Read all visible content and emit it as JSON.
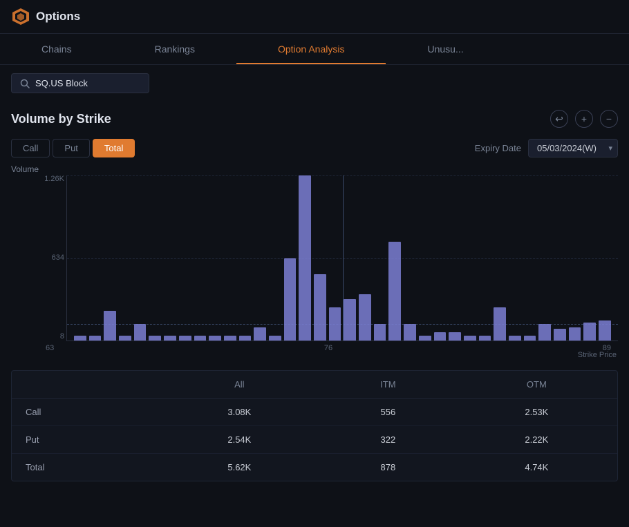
{
  "app": {
    "title": "Options"
  },
  "nav": {
    "tabs": [
      {
        "id": "chains",
        "label": "Chains",
        "active": false
      },
      {
        "id": "rankings",
        "label": "Rankings",
        "active": false
      },
      {
        "id": "option-analysis",
        "label": "Option Analysis",
        "active": true
      },
      {
        "id": "unusual",
        "label": "Unusu...",
        "active": false
      }
    ]
  },
  "search": {
    "value": "SQ.US Block",
    "placeholder": "Search..."
  },
  "section": {
    "title": "Volume by Strike",
    "toolbar": {
      "reset": "↩",
      "zoom_in": "+",
      "zoom_out": "−"
    }
  },
  "filters": {
    "buttons": [
      {
        "id": "call",
        "label": "Call",
        "active": false
      },
      {
        "id": "put",
        "label": "Put",
        "active": false
      },
      {
        "id": "total",
        "label": "Total",
        "active": true
      }
    ],
    "expiry_label": "Expiry Date",
    "expiry_value": "05/03/2024(W)"
  },
  "chart": {
    "y_labels": [
      "1.26K",
      "634",
      "8"
    ],
    "x_labels": [
      "63",
      "76",
      "89"
    ],
    "strike_label": "Strike Price",
    "volume_label": "Volume",
    "bars": [
      {
        "height_pct": 3
      },
      {
        "height_pct": 3
      },
      {
        "height_pct": 18
      },
      {
        "height_pct": 3
      },
      {
        "height_pct": 10
      },
      {
        "height_pct": 3
      },
      {
        "height_pct": 3
      },
      {
        "height_pct": 3
      },
      {
        "height_pct": 3
      },
      {
        "height_pct": 3
      },
      {
        "height_pct": 3
      },
      {
        "height_pct": 3
      },
      {
        "height_pct": 8
      },
      {
        "height_pct": 3
      },
      {
        "height_pct": 50
      },
      {
        "height_pct": 100
      },
      {
        "height_pct": 40
      },
      {
        "height_pct": 20
      },
      {
        "height_pct": 25
      },
      {
        "height_pct": 28
      },
      {
        "height_pct": 10
      },
      {
        "height_pct": 60
      },
      {
        "height_pct": 10
      },
      {
        "height_pct": 3
      },
      {
        "height_pct": 5
      },
      {
        "height_pct": 5
      },
      {
        "height_pct": 3
      },
      {
        "height_pct": 3
      },
      {
        "height_pct": 20
      },
      {
        "height_pct": 3
      },
      {
        "height_pct": 3
      },
      {
        "height_pct": 10
      },
      {
        "height_pct": 7
      },
      {
        "height_pct": 8
      },
      {
        "height_pct": 11
      },
      {
        "height_pct": 12
      }
    ]
  },
  "table": {
    "headers": [
      "",
      "All",
      "ITM",
      "OTM"
    ],
    "rows": [
      {
        "label": "Call",
        "all": "3.08K",
        "itm": "556",
        "otm": "2.53K"
      },
      {
        "label": "Put",
        "all": "2.54K",
        "itm": "322",
        "otm": "2.22K"
      },
      {
        "label": "Total",
        "all": "5.62K",
        "itm": "878",
        "otm": "4.74K"
      }
    ]
  }
}
